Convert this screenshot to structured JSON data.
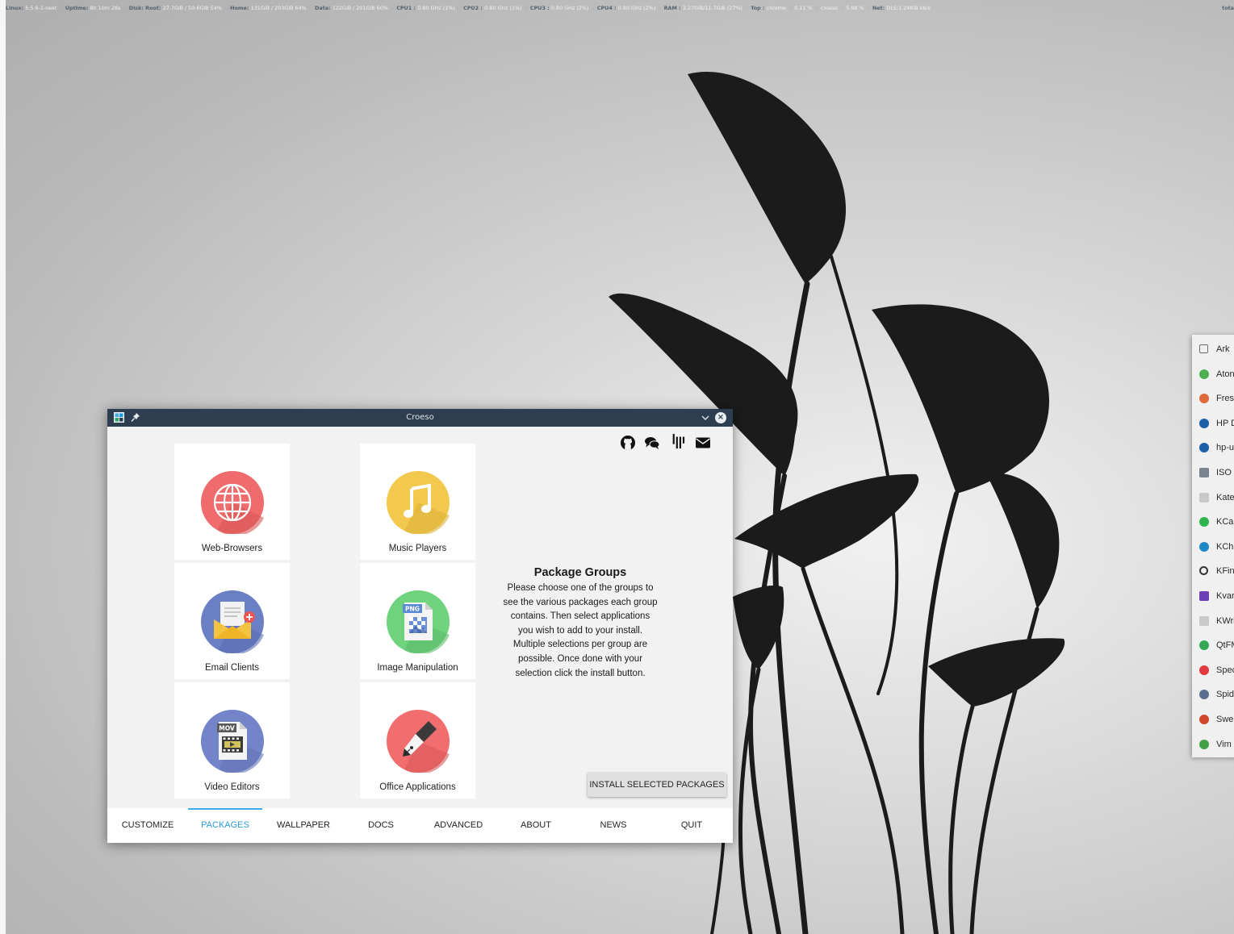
{
  "conky": {
    "items": [
      {
        "key": "Linux:",
        "value": "5.5.6-1-next"
      },
      {
        "key": "Uptime:",
        "value": "8h 10m 28s"
      },
      {
        "key": "Disk: Root:",
        "value": "27.7GiB / 50.6GiB 54%"
      },
      {
        "key": "Home:",
        "value": "131GiB / 203GiB 64%"
      },
      {
        "key": "Data:",
        "value": "122GiB / 201GiB 60%"
      },
      {
        "key": "CPU1 :",
        "value": "0.80 GHz (1%)"
      },
      {
        "key": "CPU2 :",
        "value": "0.80 GHz (1%)"
      },
      {
        "key": "CPU3 :",
        "value": "0.80 GHz (2%)"
      },
      {
        "key": "CPU4 :",
        "value": "0.80 GHz (2%)"
      },
      {
        "key": "RAM :",
        "value": "3.27GiB/11.7GiB (27%)"
      },
      {
        "key": "Top :",
        "value": "chrome"
      },
      {
        "key": "",
        "value": "0.11 %"
      },
      {
        "key": "",
        "value": "croeso"
      },
      {
        "key": "",
        "value": "5.98 %"
      },
      {
        "key": "Net:",
        "value": "DLS:1.24KiB kb/s"
      }
    ],
    "total": "tota"
  },
  "window": {
    "title": "Croeso",
    "tiles": [
      {
        "label": "Web-Browsers",
        "icon": "globe-icon"
      },
      {
        "label": "Music Players",
        "icon": "music-note-icon"
      },
      {
        "label": "Email Clients",
        "icon": "envelope-icon"
      },
      {
        "label": "Image Manipulation",
        "icon": "png-image-icon"
      },
      {
        "label": "Video Editors",
        "icon": "mov-video-icon"
      },
      {
        "label": "Office Applications",
        "icon": "fountain-pen-icon"
      }
    ],
    "png_badge": "PNG",
    "mov_badge": "MOV",
    "social_icons": [
      "github-icon",
      "chat-icon",
      "gitter-icon",
      "mail-icon"
    ],
    "info": {
      "title": "Package Groups",
      "lines": [
        "Please choose one of the groups to",
        "see the various packages each group",
        "contains. Then select applications",
        "you wish to add to your install.",
        "Multiple selections per group are",
        "possible. Once done with your",
        "selection click the install button."
      ]
    },
    "install_label": "INSTALL SELECTED PACKAGES",
    "tabs": [
      {
        "label": "CUSTOMIZE",
        "active": false
      },
      {
        "label": "PACKAGES",
        "active": true
      },
      {
        "label": "WALLPAPER",
        "active": false
      },
      {
        "label": "DOCS",
        "active": false
      },
      {
        "label": "ADVANCED",
        "active": false
      },
      {
        "label": "ABOUT",
        "active": false
      },
      {
        "label": "NEWS",
        "active": false
      },
      {
        "label": "QUIT",
        "active": false
      }
    ]
  },
  "side_menu": {
    "items": [
      {
        "label": "Ark",
        "icon": "ark-icon",
        "color": "#6b6b6b"
      },
      {
        "label": "Aton",
        "icon": "atom-icon",
        "color": "#4caf50"
      },
      {
        "label": "Fres",
        "icon": "freshmaker-icon",
        "color": "#e0693a"
      },
      {
        "label": "HP D",
        "icon": "hp-icon",
        "color": "#1a5fa8"
      },
      {
        "label": "hp-u",
        "icon": "hp-icon",
        "color": "#1a5fa8"
      },
      {
        "label": "ISO V",
        "icon": "iso-writer-icon",
        "color": "#7a8490"
      },
      {
        "label": "Kate",
        "icon": "kate-icon",
        "color": "#c9c9c9"
      },
      {
        "label": "KCal",
        "icon": "kcalc-icon",
        "color": "#2db34a"
      },
      {
        "label": "KCha",
        "icon": "kcharselect-icon",
        "color": "#1e88c7"
      },
      {
        "label": "KFin",
        "icon": "search-icon",
        "color": "#333333"
      },
      {
        "label": "Kvar",
        "icon": "kvantum-icon",
        "color": "#6c3fb6"
      },
      {
        "label": "KWri",
        "icon": "kwrite-icon",
        "color": "#c9c9c9"
      },
      {
        "label": "QtFM",
        "icon": "qtfm-icon",
        "color": "#34a853"
      },
      {
        "label": "Spec",
        "icon": "spectacle-icon",
        "color": "#e0393e"
      },
      {
        "label": "Spid",
        "icon": "spyder-icon",
        "color": "#5a6f8f"
      },
      {
        "label": "Swe",
        "icon": "sweeper-icon",
        "color": "#d2452f"
      },
      {
        "label": "Vim",
        "icon": "vim-icon",
        "color": "#43a047"
      }
    ]
  },
  "colors": {
    "titlebar": "#2c3e50",
    "accent": "#3daee9",
    "tile_bg": "#ffffff",
    "window_bg": "#f2f2f2",
    "wallpaper_plant": "#1b1b1b"
  }
}
